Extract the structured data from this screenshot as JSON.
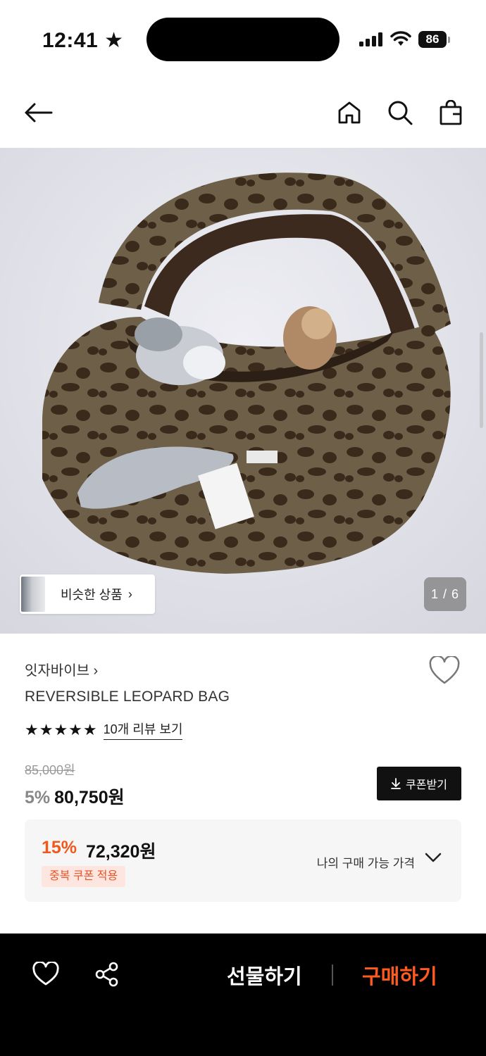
{
  "status_bar": {
    "time": "12:41 ★",
    "battery": "86"
  },
  "nav": {
    "back": "back",
    "home": "home",
    "search": "search",
    "cart": "cart"
  },
  "hero": {
    "similar_label": "비슷한 상품",
    "similar_chevron": "›",
    "page_indicator": "1 / 6"
  },
  "product": {
    "brand": "잇자바이브 ›",
    "name": "REVERSIBLE LEOPARD BAG",
    "rating_stars": 5,
    "stars_text": "★★★★★",
    "review_link": "10개 리뷰 보기",
    "original_price": "85,000원",
    "discount_pct": "5%",
    "sale_price": "80,750원",
    "coupon_button": "쿠폰받기"
  },
  "my_price": {
    "pct": "15%",
    "price": "72,320원",
    "badge": "중복 쿠폰 적용",
    "label": "나의 구매 가능 가격"
  },
  "bottom_bar": {
    "gift": "선물하기",
    "buy": "구매하기"
  },
  "colors": {
    "accent_orange": "#ff5a1f",
    "price_orange": "#ef5a1c",
    "badge_bg": "#fde6df",
    "dark": "#111111"
  }
}
